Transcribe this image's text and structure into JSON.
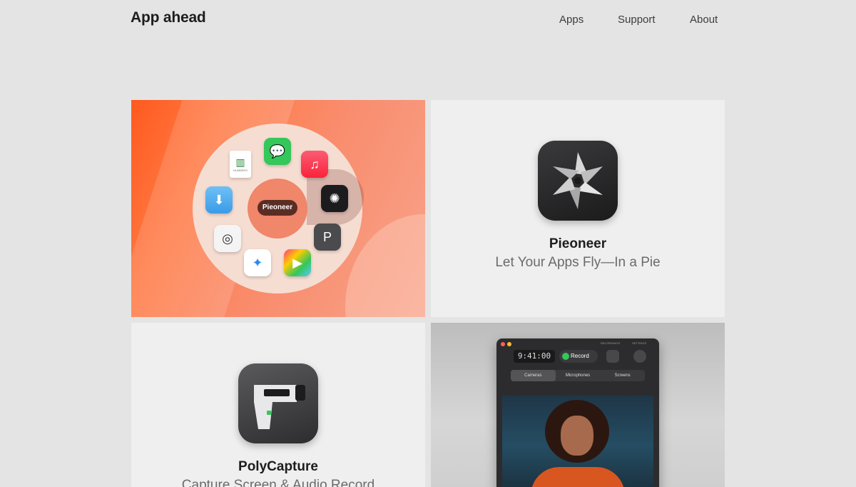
{
  "header": {
    "logo": "App ahead",
    "nav": [
      "Apps",
      "Support",
      "About"
    ]
  },
  "pieoneer_tile": {
    "pie_label": "Pieoneer",
    "numbers_label": "NUMBERS",
    "title": "Pieoneer",
    "subtitle": "Let Your Apps Fly—In a Pie"
  },
  "polycapture_tile": {
    "title": "PolyCapture",
    "subtitle_partial": "Capture Screen & Audio Record"
  },
  "recorder_window": {
    "timer": "9:41:00",
    "record_label": "Record",
    "top_labels": [
      "RECORDINGS",
      "SETTINGS"
    ],
    "tabs": [
      "Cameras",
      "Microphones",
      "Screens"
    ]
  },
  "colors": {
    "background": "#e4e4e4",
    "tile_bg": "#efefef",
    "accent_orange": "#ff5a1e",
    "record_green": "#34c759"
  }
}
